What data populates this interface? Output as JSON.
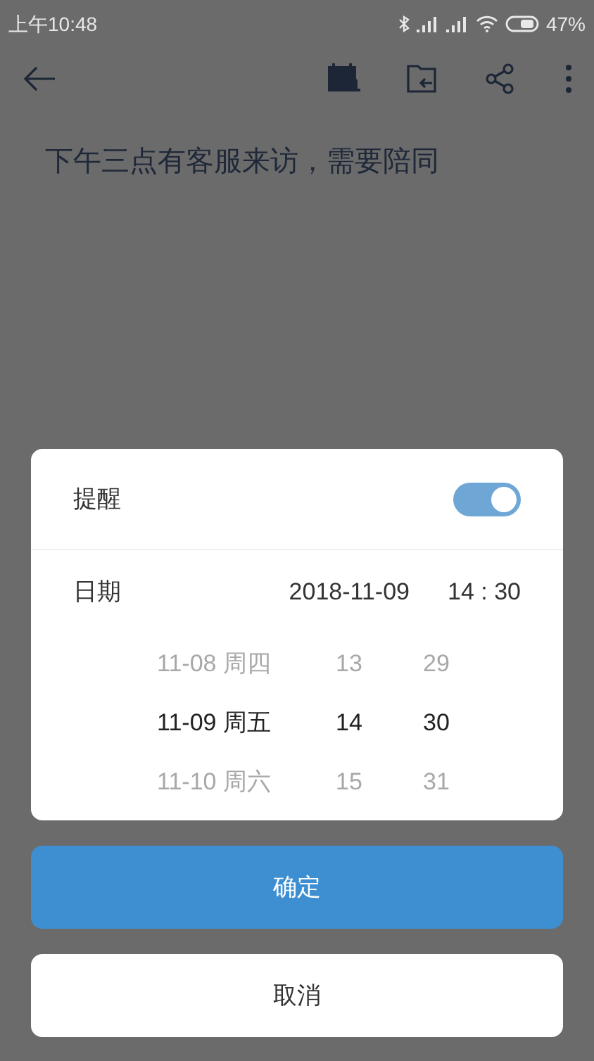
{
  "status_bar": {
    "time": "上午10:48",
    "battery": "47%"
  },
  "note": {
    "text": "下午三点有客服来访，需要陪同"
  },
  "dialog": {
    "reminder": {
      "label": "提醒",
      "on": true
    },
    "date_row": {
      "label": "日期",
      "date": "2018-11-09",
      "time": "14 : 30"
    },
    "picker": [
      {
        "items": [
          {
            "text": "11-08 周四",
            "selected": false
          },
          {
            "text": "11-09 周五",
            "selected": true
          },
          {
            "text": "11-10 周六",
            "selected": false
          }
        ]
      },
      {
        "items": [
          {
            "text": "13",
            "selected": false
          },
          {
            "text": "14",
            "selected": true
          },
          {
            "text": "15",
            "selected": false
          }
        ]
      },
      {
        "items": [
          {
            "text": "29",
            "selected": false
          },
          {
            "text": "30",
            "selected": true
          },
          {
            "text": "31",
            "selected": false
          }
        ]
      }
    ]
  },
  "buttons": [
    {
      "kind": "primary",
      "label": "确定"
    },
    {
      "kind": "secondary",
      "label": "取消"
    }
  ]
}
